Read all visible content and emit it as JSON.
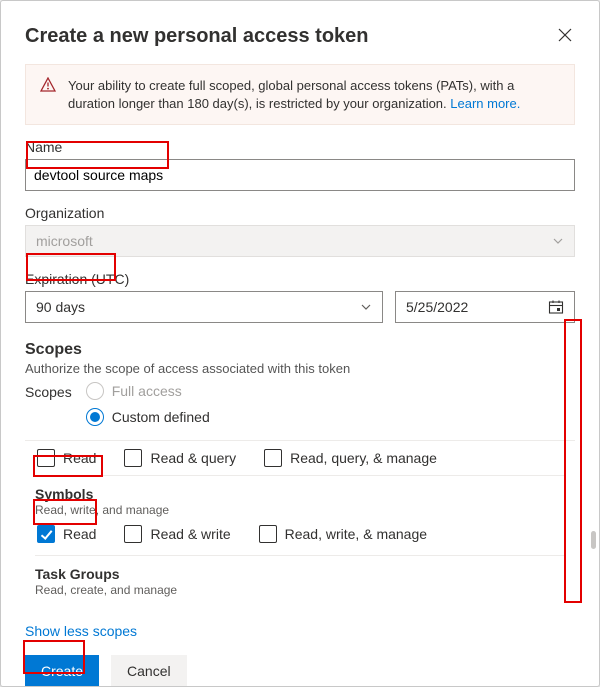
{
  "header": {
    "title": "Create a new personal access token"
  },
  "banner": {
    "text1": "Your ability to create full scoped, global personal access tokens (PATs), with a duration longer than 180 day(s), is restricted by your organization. ",
    "link": "Learn more."
  },
  "fields": {
    "name_label": "Name",
    "name_value": "devtool source maps",
    "org_label": "Organization",
    "org_value": "microsoft",
    "expiration_label": "Expiration (UTC)",
    "expiration_value": "90 days",
    "expiration_date": "5/25/2022"
  },
  "scopes": {
    "heading": "Scopes",
    "subheading": "Authorize the scope of access associated with this token",
    "mode_label": "Scopes",
    "full_access_label": "Full access",
    "custom_defined_label": "Custom defined",
    "row1": {
      "c1": "Read",
      "c2": "Read & query",
      "c3": "Read, query, & manage"
    },
    "symbols": {
      "title": "Symbols",
      "desc": "Read, write, and manage",
      "c1": "Read",
      "c2": "Read & write",
      "c3": "Read, write, & manage"
    },
    "task_groups": {
      "title": "Task Groups",
      "desc": "Read, create, and manage"
    }
  },
  "footer": {
    "show_less": "Show less scopes",
    "create": "Create",
    "cancel": "Cancel"
  }
}
